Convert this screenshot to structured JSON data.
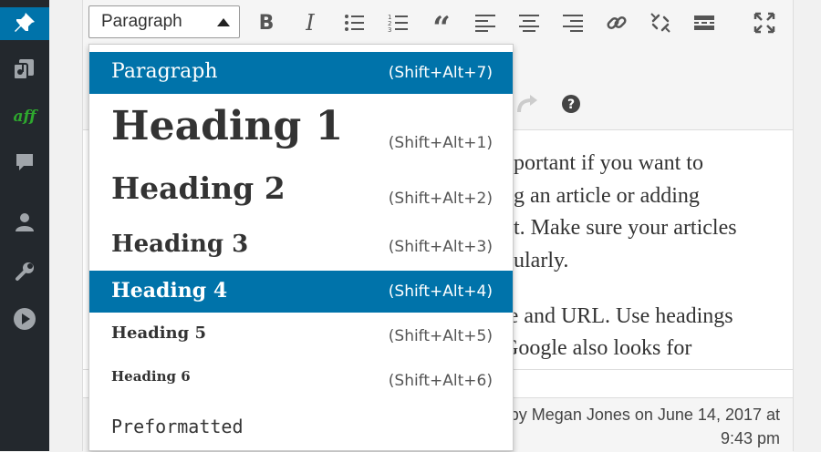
{
  "sidebar": {
    "items": [
      {
        "icon": "pin-icon",
        "active": true
      },
      {
        "icon": "media-icon",
        "active": false
      },
      {
        "icon": "aff-icon",
        "label": "aff",
        "active": false
      },
      {
        "icon": "comments-icon",
        "active": false
      },
      {
        "icon": "users-icon",
        "active": false
      },
      {
        "icon": "tools-icon",
        "active": false
      },
      {
        "icon": "play-icon",
        "active": false
      }
    ]
  },
  "toolbar": {
    "format_value": "Paragraph",
    "buttons": [
      "bold-icon",
      "italic-icon",
      "bullet-list-icon",
      "numbered-list-icon",
      "blockquote-icon",
      "align-left-icon",
      "align-center-icon",
      "align-right-icon",
      "link-icon",
      "unlink-icon",
      "read-more-icon",
      "fullscreen-icon"
    ],
    "row2_buttons": [
      "redo-icon",
      "help-icon"
    ]
  },
  "dropdown": {
    "items": [
      {
        "label": "Paragraph",
        "shortcut": "(Shift+Alt+7)",
        "selected": true
      },
      {
        "label": "Heading 1",
        "shortcut": "(Shift+Alt+1)",
        "selected": false
      },
      {
        "label": "Heading 2",
        "shortcut": "(Shift+Alt+2)",
        "selected": false
      },
      {
        "label": "Heading 3",
        "shortcut": "(Shift+Alt+3)",
        "selected": false
      },
      {
        "label": "Heading 4",
        "shortcut": "(Shift+Alt+4)",
        "selected": true
      },
      {
        "label": "Heading 5",
        "shortcut": "(Shift+Alt+5)",
        "selected": false
      },
      {
        "label": "Heading 6",
        "shortcut": "(Shift+Alt+6)",
        "selected": false
      },
      {
        "label": "Preformatted",
        "shortcut": "",
        "selected": false
      }
    ]
  },
  "content": {
    "lines": [
      "nportant if you want to",
      "ng an article or adding",
      "xt. Make sure your articles",
      "gularly.",
      "le and URL. Use headings",
      "Google also looks for"
    ]
  },
  "footer": {
    "line1": "by Megan Jones on June 14, 2017 at",
    "line2": "9:43 pm"
  },
  "colors": {
    "accent": "#0073aa",
    "sidebar": "#23282d",
    "aff_green": "#2ea82e"
  }
}
